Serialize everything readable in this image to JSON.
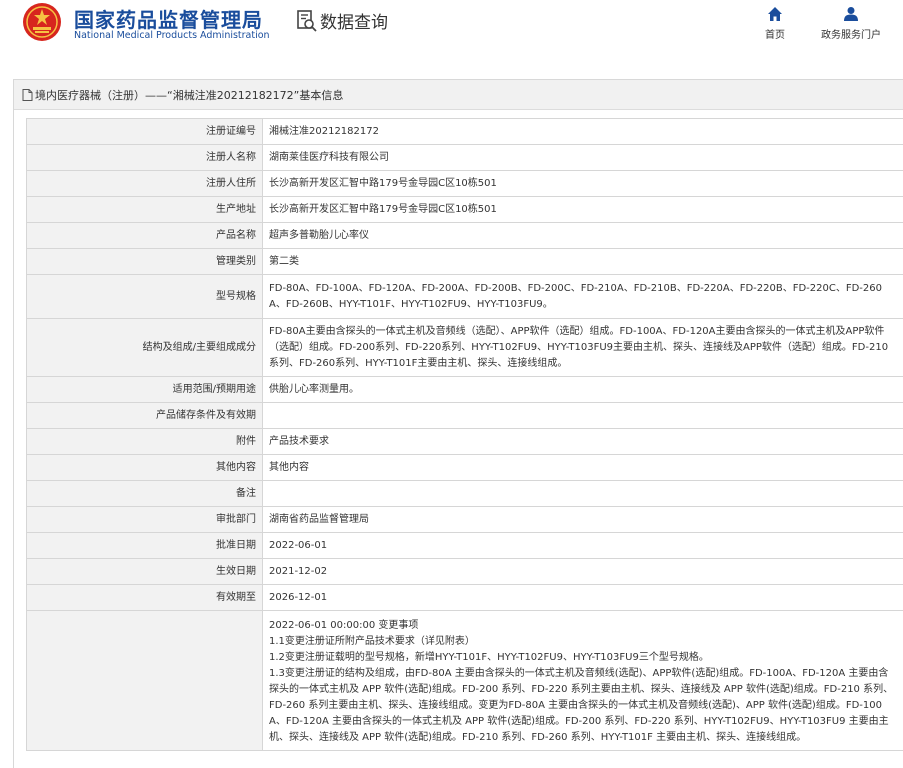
{
  "header": {
    "site_name_cn": "国家药品监督管理局",
    "site_name_en": "National Medical Products Administration",
    "query_label": "数据查询",
    "nav": {
      "home": "首页",
      "portal": "政务服务门户"
    }
  },
  "panel": {
    "title": "境内医疗器械（注册）——“湘械注准20212182172”基本信息"
  },
  "rows": [
    {
      "label": "注册证编号",
      "value": "湘械注准20212182172"
    },
    {
      "label": "注册人名称",
      "value": "湖南莱佳医疗科技有限公司"
    },
    {
      "label": "注册人住所",
      "value": "长沙高新开发区汇智中路179号金导园C区10栋501"
    },
    {
      "label": "生产地址",
      "value": "长沙高新开发区汇智中路179号金导园C区10栋501"
    },
    {
      "label": "产品名称",
      "value": "超声多普勒胎儿心率仪"
    },
    {
      "label": "管理类别",
      "value": "第二类"
    },
    {
      "label": "型号规格",
      "value": "FD-80A、FD-100A、FD-120A、FD-200A、FD-200B、FD-200C、FD-210A、FD-210B、FD-220A、FD-220B、FD-220C、FD-260A、FD-260B、HYY-T101F、HYY-T102FU9、HYY-T103FU9。"
    },
    {
      "label": "结构及组成/主要组成成分",
      "value": "FD-80A主要由含探头的一体式主机及音频线（选配）、APP软件（选配）组成。FD-100A、FD-120A主要由含探头的一体式主机及APP软件（选配）组成。FD-200系列、FD-220系列、HYY-T102FU9、HYY-T103FU9主要由主机、探头、连接线及APP软件（选配）组成。FD-210系列、FD-260系列、HYY-T101F主要由主机、探头、连接线组成。"
    },
    {
      "label": "适用范围/预期用途",
      "value": "供胎儿心率测量用。"
    },
    {
      "label": "产品储存条件及有效期",
      "value": ""
    },
    {
      "label": "附件",
      "value": "产品技术要求"
    },
    {
      "label": "其他内容",
      "value": "其他内容"
    },
    {
      "label": "备注",
      "value": ""
    },
    {
      "label": "审批部门",
      "value": "湖南省药品监督管理局"
    },
    {
      "label": "批准日期",
      "value": "2022-06-01"
    },
    {
      "label": "生效日期",
      "value": "2021-12-02"
    },
    {
      "label": "有效期至",
      "value": "2026-12-01"
    }
  ],
  "change_record": {
    "label": "",
    "lines": [
      "2022-06-01 00:00:00 变更事项",
      "1.1变更注册证所附产品技术要求（详见附表）",
      "1.2变更注册证载明的型号规格，新增HYY-T101F、HYY-T102FU9、HYY-T103FU9三个型号规格。",
      "1.3变更注册证的结构及组成，由FD-80A 主要由含探头的一体式主机及音频线(选配)、APP软件(选配)组成。FD-100A、FD-120A 主要由含探头的一体式主机及 APP 软件(选配)组成。FD-200 系列、FD-220 系列主要由主机、探头、连接线及 APP 软件(选配)组成。FD-210 系列、FD-260 系列主要由主机、探头、连接线组成。变更为FD-80A 主要由含探头的一体式主机及音频线(选配)、APP 软件(选配)组成。FD-100A、FD-120A 主要由含探头的一体式主机及 APP 软件(选配)组成。FD-200 系列、FD-220 系列、HYY-T102FU9、HYY-T103FU9 主要由主机、探头、连接线及 APP 软件(选配)组成。FD-210 系列、FD-260 系列、HYY-T101F 主要由主机、探头、连接线组成。"
    ]
  },
  "colors": {
    "brand_blue": "#1a4d9c",
    "logo_red": "#d7261e",
    "label_bg": "#f2f2f2",
    "border": "#d6d6d6"
  },
  "icons": {
    "logo": "nmpa-emblem-icon",
    "query": "data-search-icon",
    "home": "home-icon",
    "portal": "user-icon",
    "title": "document-icon"
  }
}
